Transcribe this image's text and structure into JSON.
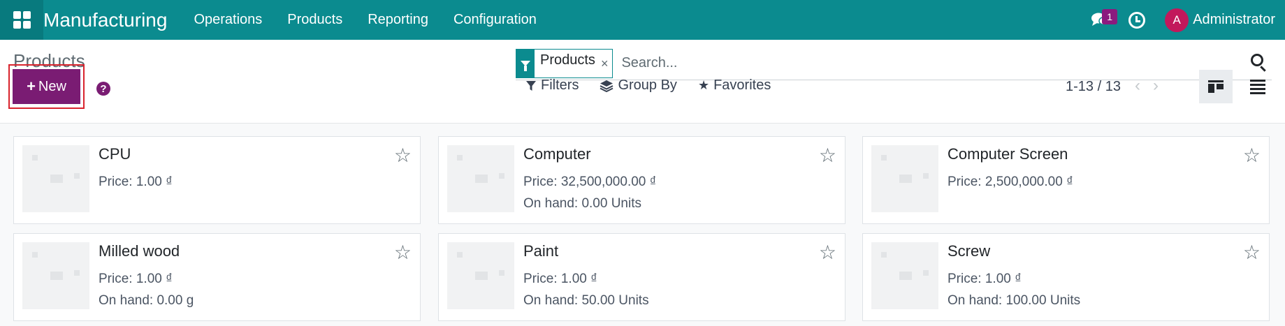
{
  "navbar": {
    "app_title": "Manufacturing",
    "menu": [
      "Operations",
      "Products",
      "Reporting",
      "Configuration"
    ],
    "chat_badge": "1",
    "user_initial": "A",
    "user_name": "Administrator",
    "color": "#0b8b8f"
  },
  "control": {
    "breadcrumb": "Products",
    "new_label": "New",
    "help_glyph": "?",
    "search": {
      "facet": "Products",
      "facet_remove": "×",
      "placeholder": "Search..."
    },
    "filters": "Filters",
    "group_by": "Group By",
    "favorites": "Favorites",
    "pager": "1-13 / 13",
    "accent": "#7a1c73"
  },
  "cards": [
    {
      "name": "CPU",
      "price": "Price: 1.00 ₫",
      "on_hand": ""
    },
    {
      "name": "Computer",
      "price": "Price: 32,500,000.00 ₫",
      "on_hand": "On hand: 0.00 Units"
    },
    {
      "name": "Computer Screen",
      "price": "Price: 2,500,000.00 ₫",
      "on_hand": ""
    },
    {
      "name": "Milled wood",
      "price": "Price: 1.00 ₫",
      "on_hand": "On hand: 0.00 g"
    },
    {
      "name": "Paint",
      "price": "Price: 1.00 ₫",
      "on_hand": "On hand: 50.00 Units"
    },
    {
      "name": "Screw",
      "price": "Price: 1.00 ₫",
      "on_hand": "On hand: 100.00 Units"
    }
  ]
}
